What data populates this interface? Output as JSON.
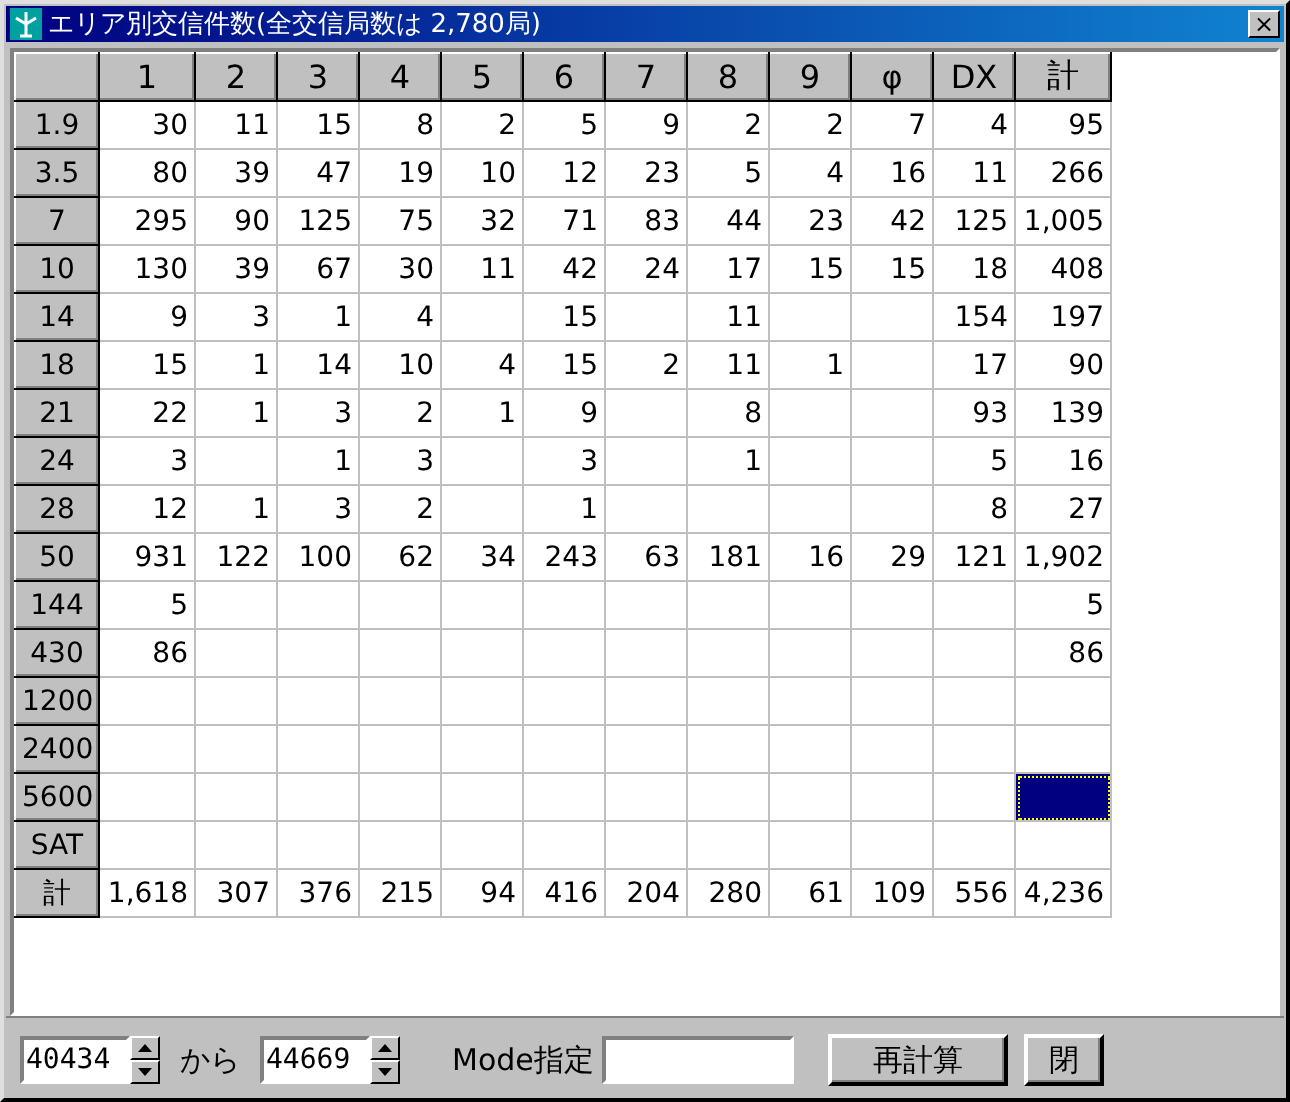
{
  "window": {
    "title": "エリア別交信件数(全交信局数は 2,780局)",
    "close": "×"
  },
  "table": {
    "columns": [
      "1",
      "2",
      "3",
      "4",
      "5",
      "6",
      "7",
      "8",
      "9",
      "φ",
      "DX",
      "計"
    ],
    "rows": [
      {
        "label": "1.9",
        "cells": [
          {
            "text": "30",
            "selected": false
          },
          {
            "text": "11",
            "selected": false
          },
          {
            "text": "15",
            "selected": false
          },
          {
            "text": "8",
            "selected": false
          },
          {
            "text": "2",
            "selected": false
          },
          {
            "text": "5",
            "selected": false
          },
          {
            "text": "9",
            "selected": false
          },
          {
            "text": "2",
            "selected": false
          },
          {
            "text": "2",
            "selected": false
          },
          {
            "text": "7",
            "selected": false
          },
          {
            "text": "4",
            "selected": false
          },
          {
            "text": "95",
            "selected": false
          }
        ]
      },
      {
        "label": "3.5",
        "cells": [
          {
            "text": "80",
            "selected": false
          },
          {
            "text": "39",
            "selected": false
          },
          {
            "text": "47",
            "selected": false
          },
          {
            "text": "19",
            "selected": false
          },
          {
            "text": "10",
            "selected": false
          },
          {
            "text": "12",
            "selected": false
          },
          {
            "text": "23",
            "selected": false
          },
          {
            "text": "5",
            "selected": false
          },
          {
            "text": "4",
            "selected": false
          },
          {
            "text": "16",
            "selected": false
          },
          {
            "text": "11",
            "selected": false
          },
          {
            "text": "266",
            "selected": false
          }
        ]
      },
      {
        "label": "7",
        "cells": [
          {
            "text": "295",
            "selected": false
          },
          {
            "text": "90",
            "selected": false
          },
          {
            "text": "125",
            "selected": false
          },
          {
            "text": "75",
            "selected": false
          },
          {
            "text": "32",
            "selected": false
          },
          {
            "text": "71",
            "selected": false
          },
          {
            "text": "83",
            "selected": false
          },
          {
            "text": "44",
            "selected": false
          },
          {
            "text": "23",
            "selected": false
          },
          {
            "text": "42",
            "selected": false
          },
          {
            "text": "125",
            "selected": false
          },
          {
            "text": "1,005",
            "selected": false
          }
        ]
      },
      {
        "label": "10",
        "cells": [
          {
            "text": "130",
            "selected": false
          },
          {
            "text": "39",
            "selected": false
          },
          {
            "text": "67",
            "selected": false
          },
          {
            "text": "30",
            "selected": false
          },
          {
            "text": "11",
            "selected": false
          },
          {
            "text": "42",
            "selected": false
          },
          {
            "text": "24",
            "selected": false
          },
          {
            "text": "17",
            "selected": false
          },
          {
            "text": "15",
            "selected": false
          },
          {
            "text": "15",
            "selected": false
          },
          {
            "text": "18",
            "selected": false
          },
          {
            "text": "408",
            "selected": false
          }
        ]
      },
      {
        "label": "14",
        "cells": [
          {
            "text": "9",
            "selected": false
          },
          {
            "text": "3",
            "selected": false
          },
          {
            "text": "1",
            "selected": false
          },
          {
            "text": "4",
            "selected": false
          },
          {
            "selected": false
          },
          {
            "text": "15",
            "selected": false
          },
          {
            "selected": false
          },
          {
            "text": "11",
            "selected": false
          },
          {
            "selected": false
          },
          {
            "selected": false
          },
          {
            "text": "154",
            "selected": false
          },
          {
            "text": "197",
            "selected": false
          }
        ]
      },
      {
        "label": "18",
        "cells": [
          {
            "text": "15",
            "selected": false
          },
          {
            "text": "1",
            "selected": false
          },
          {
            "text": "14",
            "selected": false
          },
          {
            "text": "10",
            "selected": false
          },
          {
            "text": "4",
            "selected": false
          },
          {
            "text": "15",
            "selected": false
          },
          {
            "text": "2",
            "selected": false
          },
          {
            "text": "11",
            "selected": false
          },
          {
            "text": "1",
            "selected": false
          },
          {
            "selected": false
          },
          {
            "text": "17",
            "selected": false
          },
          {
            "text": "90",
            "selected": false
          }
        ]
      },
      {
        "label": "21",
        "cells": [
          {
            "text": "22",
            "selected": false
          },
          {
            "text": "1",
            "selected": false
          },
          {
            "text": "3",
            "selected": false
          },
          {
            "text": "2",
            "selected": false
          },
          {
            "text": "1",
            "selected": false
          },
          {
            "text": "9",
            "selected": false
          },
          {
            "selected": false
          },
          {
            "text": "8",
            "selected": false
          },
          {
            "selected": false
          },
          {
            "selected": false
          },
          {
            "text": "93",
            "selected": false
          },
          {
            "text": "139",
            "selected": false
          }
        ]
      },
      {
        "label": "24",
        "cells": [
          {
            "text": "3",
            "selected": false
          },
          {
            "selected": false
          },
          {
            "text": "1",
            "selected": false
          },
          {
            "text": "3",
            "selected": false
          },
          {
            "selected": false
          },
          {
            "text": "3",
            "selected": false
          },
          {
            "selected": false
          },
          {
            "text": "1",
            "selected": false
          },
          {
            "selected": false
          },
          {
            "selected": false
          },
          {
            "text": "5",
            "selected": false
          },
          {
            "text": "16",
            "selected": false
          }
        ]
      },
      {
        "label": "28",
        "cells": [
          {
            "text": "12",
            "selected": false
          },
          {
            "text": "1",
            "selected": false
          },
          {
            "text": "3",
            "selected": false
          },
          {
            "text": "2",
            "selected": false
          },
          {
            "selected": false
          },
          {
            "text": "1",
            "selected": false
          },
          {
            "selected": false
          },
          {
            "selected": false
          },
          {
            "selected": false
          },
          {
            "selected": false
          },
          {
            "text": "8",
            "selected": false
          },
          {
            "text": "27",
            "selected": false
          }
        ]
      },
      {
        "label": "50",
        "cells": [
          {
            "text": "931",
            "selected": false
          },
          {
            "text": "122",
            "selected": false
          },
          {
            "text": "100",
            "selected": false
          },
          {
            "text": "62",
            "selected": false
          },
          {
            "text": "34",
            "selected": false
          },
          {
            "text": "243",
            "selected": false
          },
          {
            "text": "63",
            "selected": false
          },
          {
            "text": "181",
            "selected": false
          },
          {
            "text": "16",
            "selected": false
          },
          {
            "text": "29",
            "selected": false
          },
          {
            "text": "121",
            "selected": false
          },
          {
            "text": "1,902",
            "selected": false
          }
        ]
      },
      {
        "label": "144",
        "cells": [
          {
            "text": "5",
            "selected": false
          },
          {
            "selected": false
          },
          {
            "selected": false
          },
          {
            "selected": false
          },
          {
            "selected": false
          },
          {
            "selected": false
          },
          {
            "selected": false
          },
          {
            "selected": false
          },
          {
            "selected": false
          },
          {
            "selected": false
          },
          {
            "selected": false
          },
          {
            "text": "5",
            "selected": false
          }
        ]
      },
      {
        "label": "430",
        "cells": [
          {
            "text": "86",
            "selected": false
          },
          {
            "selected": false
          },
          {
            "selected": false
          },
          {
            "selected": false
          },
          {
            "selected": false
          },
          {
            "selected": false
          },
          {
            "selected": false
          },
          {
            "selected": false
          },
          {
            "selected": false
          },
          {
            "selected": false
          },
          {
            "selected": false
          },
          {
            "text": "86",
            "selected": false
          }
        ]
      },
      {
        "label": "1200",
        "cells": [
          {
            "selected": false
          },
          {
            "selected": false
          },
          {
            "selected": false
          },
          {
            "selected": false
          },
          {
            "selected": false
          },
          {
            "selected": false
          },
          {
            "selected": false
          },
          {
            "selected": false
          },
          {
            "selected": false
          },
          {
            "selected": false
          },
          {
            "selected": false
          },
          {
            "selected": false
          }
        ]
      },
      {
        "label": "2400",
        "cells": [
          {
            "selected": false
          },
          {
            "selected": false
          },
          {
            "selected": false
          },
          {
            "selected": false
          },
          {
            "selected": false
          },
          {
            "selected": false
          },
          {
            "selected": false
          },
          {
            "selected": false
          },
          {
            "selected": false
          },
          {
            "selected": false
          },
          {
            "selected": false
          },
          {
            "selected": false
          }
        ]
      },
      {
        "label": "5600",
        "cells": [
          {
            "selected": false
          },
          {
            "selected": false
          },
          {
            "selected": false
          },
          {
            "selected": false
          },
          {
            "selected": false
          },
          {
            "selected": false
          },
          {
            "selected": false
          },
          {
            "selected": false
          },
          {
            "selected": false
          },
          {
            "selected": false
          },
          {
            "selected": false
          },
          {
            "selected": true
          }
        ]
      },
      {
        "label": "SAT",
        "cells": [
          {
            "selected": false
          },
          {
            "selected": false
          },
          {
            "selected": false
          },
          {
            "selected": false
          },
          {
            "selected": false
          },
          {
            "selected": false
          },
          {
            "selected": false
          },
          {
            "selected": false
          },
          {
            "selected": false
          },
          {
            "selected": false
          },
          {
            "selected": false
          },
          {
            "selected": false
          }
        ]
      },
      {
        "label": "計",
        "cells": [
          {
            "text": "1,618",
            "selected": false
          },
          {
            "text": "307",
            "selected": false
          },
          {
            "text": "376",
            "selected": false
          },
          {
            "text": "215",
            "selected": false
          },
          {
            "text": "94",
            "selected": false
          },
          {
            "text": "416",
            "selected": false
          },
          {
            "text": "204",
            "selected": false
          },
          {
            "text": "280",
            "selected": false
          },
          {
            "text": "61",
            "selected": false
          },
          {
            "text": "109",
            "selected": false
          },
          {
            "text": "556",
            "selected": false
          },
          {
            "text": "4,236",
            "selected": false
          }
        ]
      }
    ]
  },
  "footer": {
    "from_value": "40434",
    "from_label": "から",
    "to_value": "44669",
    "mode_label": "Mode指定",
    "recalc_button": "再計算",
    "close_button": "閉"
  }
}
